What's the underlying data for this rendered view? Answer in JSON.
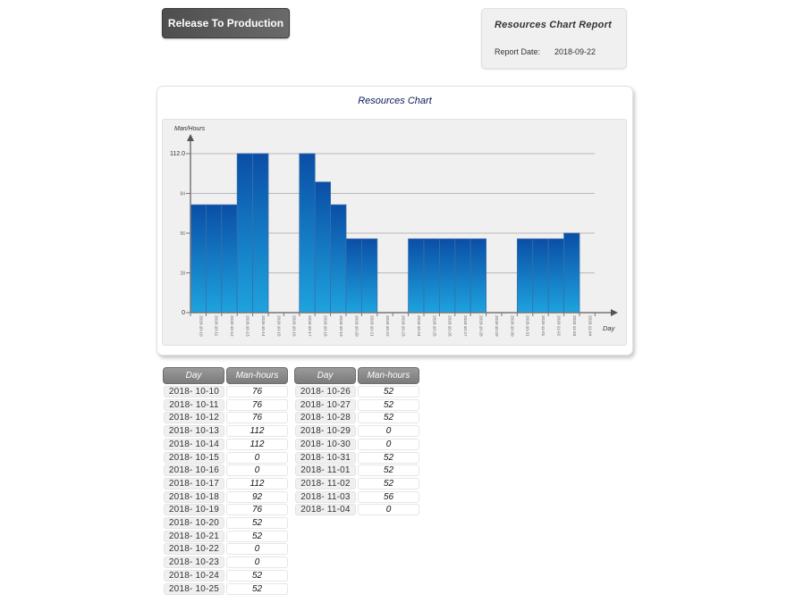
{
  "toolbar": {
    "release_label": "Release To Production"
  },
  "report": {
    "title": "Resources  Chart Report",
    "date_label": "Report Date:",
    "date_value": "2018-09-22"
  },
  "chart_data": {
    "type": "bar",
    "title": "Resources Chart",
    "xlabel": "Day",
    "ylabel": "Man/Hours",
    "ylim": [
      0,
      112
    ],
    "yticks": [
      0,
      28,
      56,
      84,
      112
    ],
    "ytick_labels": [
      "0",
      "28",
      "56",
      "84",
      "112.0"
    ],
    "grid": true,
    "legend": "none",
    "categories": [
      "2018-10-10",
      "2018-10-11",
      "2018-10-12",
      "2018-10-13",
      "2018-10-14",
      "2018-10-15",
      "2018-10-16",
      "2018-10-17",
      "2018-10-18",
      "2018-10-19",
      "2018-10-20",
      "2018-10-21",
      "2018-10-22",
      "2018-10-23",
      "2018-10-24",
      "2018-10-25",
      "2018-10-26",
      "2018-10-27",
      "2018-10-28",
      "2018-10-29",
      "2018-10-30",
      "2018-10-31",
      "2018-11-01",
      "2018-11-02",
      "2018-11-03",
      "2018-11-04"
    ],
    "values": [
      76,
      76,
      76,
      112,
      112,
      0,
      0,
      112,
      92,
      76,
      52,
      52,
      0,
      0,
      52,
      52,
      52,
      52,
      52,
      0,
      0,
      52,
      52,
      52,
      56,
      0
    ],
    "colors": {
      "bar_top": "#0a4ea6",
      "bar_bottom": "#1ea3de",
      "bar_edge": "#3a6fa8",
      "axis": "#777777",
      "grid": "#b8b8b8"
    }
  },
  "tables": {
    "headers": {
      "day": "Day",
      "hours": "Man-hours"
    },
    "left": [
      {
        "day": "2018- 10-10",
        "hours": "76"
      },
      {
        "day": "2018- 10-11",
        "hours": "76"
      },
      {
        "day": "2018- 10-12",
        "hours": "76"
      },
      {
        "day": "2018- 10-13",
        "hours": "112"
      },
      {
        "day": "2018- 10-14",
        "hours": "112"
      },
      {
        "day": "2018- 10-15",
        "hours": "0"
      },
      {
        "day": "2018- 10-16",
        "hours": "0"
      },
      {
        "day": "2018- 10-17",
        "hours": "112"
      },
      {
        "day": "2018- 10-18",
        "hours": "92"
      },
      {
        "day": "2018- 10-19",
        "hours": "76"
      },
      {
        "day": "2018- 10-20",
        "hours": "52"
      },
      {
        "day": "2018- 10-21",
        "hours": "52"
      },
      {
        "day": "2018- 10-22",
        "hours": "0"
      },
      {
        "day": "2018- 10-23",
        "hours": "0"
      },
      {
        "day": "2018- 10-24",
        "hours": "52"
      },
      {
        "day": "2018- 10-25",
        "hours": "52"
      }
    ],
    "right": [
      {
        "day": "2018- 10-26",
        "hours": "52"
      },
      {
        "day": "2018- 10-27",
        "hours": "52"
      },
      {
        "day": "2018- 10-28",
        "hours": "52"
      },
      {
        "day": "2018- 10-29",
        "hours": "0"
      },
      {
        "day": "2018- 10-30",
        "hours": "0"
      },
      {
        "day": "2018- 10-31",
        "hours": "52"
      },
      {
        "day": "2018- 11-01",
        "hours": "52"
      },
      {
        "day": "2018- 11-02",
        "hours": "52"
      },
      {
        "day": "2018- 11-03",
        "hours": "56"
      },
      {
        "day": "2018- 11-04",
        "hours": "0"
      }
    ]
  }
}
